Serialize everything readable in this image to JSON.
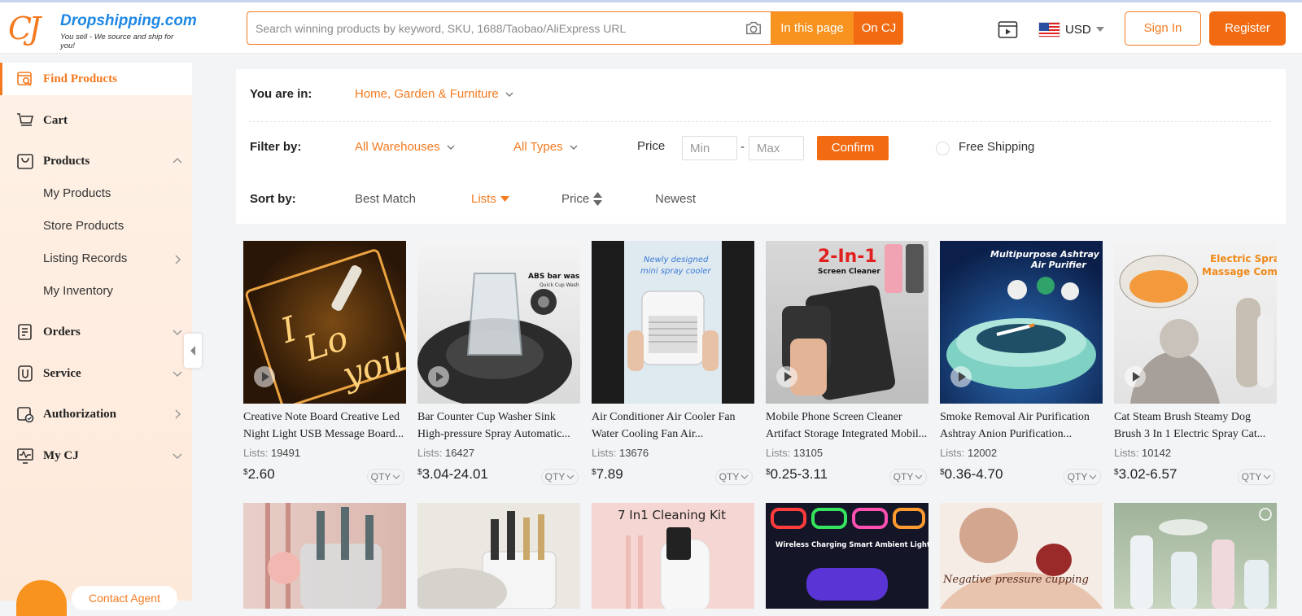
{
  "header": {
    "logo_mark": "CJ",
    "brand": "Dropshipping.com",
    "tagline": "You sell - We source and ship for you!",
    "search_placeholder": "Search winning products by keyword, SKU, 1688/Taobao/AliExpress URL",
    "btn_in_page": "In this page",
    "btn_on_cj": "On CJ",
    "currency": "USD",
    "sign_in": "Sign In",
    "register": "Register"
  },
  "sidebar": {
    "items": [
      {
        "label": "Find Products",
        "icon": "find-products-icon"
      },
      {
        "label": "Cart",
        "icon": "cart-icon"
      },
      {
        "label": "Products",
        "icon": "products-icon"
      },
      {
        "label": "Orders",
        "icon": "orders-icon"
      },
      {
        "label": "Service",
        "icon": "service-icon"
      },
      {
        "label": "Authorization",
        "icon": "authorization-icon"
      },
      {
        "label": "My CJ",
        "icon": "my-cj-icon"
      }
    ],
    "sub_items": [
      "My Products",
      "Store Products",
      "Listing Records",
      "My Inventory"
    ],
    "contact": "Contact Agent"
  },
  "filters": {
    "you_are_in_label": "You are in:",
    "category": "Home, Garden & Furniture",
    "filter_by_label": "Filter by:",
    "warehouses": "All Warehouses",
    "types": "All Types",
    "price_label": "Price",
    "min_placeholder": "Min",
    "dash": "-",
    "max_placeholder": "Max",
    "confirm": "Confirm",
    "free_shipping": "Free Shipping",
    "sort_by_label": "Sort by:",
    "sort_options": [
      "Best Match",
      "Lists",
      "Price",
      "Newest"
    ]
  },
  "products": [
    {
      "title1": "Creative Note Board Creative Led",
      "title2": "Night Light USB Message Board...",
      "lists_label": "Lists:",
      "lists": "19491",
      "currency": "$",
      "price": "2.60",
      "qty": "QTY"
    },
    {
      "title1": "Bar Counter Cup Washer Sink",
      "title2": "High-pressure Spray Automatic...",
      "lists_label": "Lists:",
      "lists": "16427",
      "currency": "$",
      "price": "3.04-24.01",
      "qty": "QTY",
      "overlay1": "ABS bar washer",
      "overlay2": "Quick Cup Wash"
    },
    {
      "title1": "Air Conditioner Air Cooler Fan",
      "title2": "Water Cooling Fan Air...",
      "lists_label": "Lists:",
      "lists": "13676",
      "currency": "$",
      "price": "7.89",
      "qty": "QTY",
      "overlay1": "Newly designed",
      "overlay2": "mini spray cooler"
    },
    {
      "title1": "Mobile Phone Screen Cleaner",
      "title2": "Artifact Storage Integrated Mobil...",
      "lists_label": "Lists:",
      "lists": "13105",
      "currency": "$",
      "price": "0.25-3.11",
      "qty": "QTY",
      "overlay1": "2-In-1",
      "overlay2": "Screen Cleaner"
    },
    {
      "title1": "Smoke Removal Air Purification",
      "title2": "Ashtray Anion Purification...",
      "lists_label": "Lists:",
      "lists": "12002",
      "currency": "$",
      "price": "0.36-4.70",
      "qty": "QTY",
      "overlay1": "Multipurpose Ashtray",
      "overlay2": "Air Purifier"
    },
    {
      "title1": "Cat Steam Brush Steamy Dog",
      "title2": "Brush 3 In 1 Electric Spray Cat...",
      "lists_label": "Lists:",
      "lists": "10142",
      "currency": "$",
      "price": "3.02-6.57",
      "qty": "QTY",
      "overlay1": "Electric Spray",
      "overlay2": "Massage Comb"
    }
  ],
  "row2_overlays": {
    "p9": "7 In1 Cleaning Kit",
    "p10": "Wireless Charging Smart  Ambient Lighting",
    "p11": "Negative pressure cupping"
  }
}
